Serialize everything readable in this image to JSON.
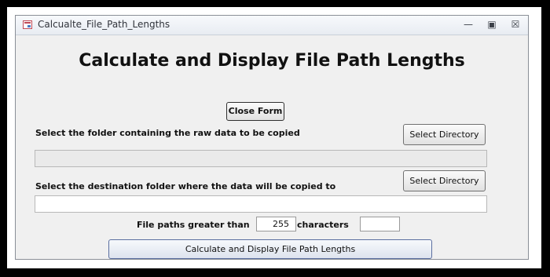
{
  "window": {
    "title": "Calcualte_File_Path_Lengths",
    "minimize_glyph": "—",
    "maximize_glyph": "▣",
    "close_glyph": "☒"
  },
  "form": {
    "heading": "Calculate and Display File Path Lengths",
    "close_button": "Close Form",
    "source_label": "Select the folder containing the raw data to be copied",
    "source_button": "Select Directory",
    "source_value": "",
    "dest_label": "Select the destination folder where the data will be copied to",
    "dest_button": "Select Directory",
    "dest_value": "",
    "threshold_prefix": "File paths greater than",
    "threshold_value": "255",
    "threshold_suffix": "characters",
    "result_value": "",
    "calc_button": "Calculate and Display File Path Lengths"
  },
  "colors": {
    "outer_background": "#000000",
    "form_background": "#f0f0f0",
    "app_icon_accent": "#c14b57"
  }
}
